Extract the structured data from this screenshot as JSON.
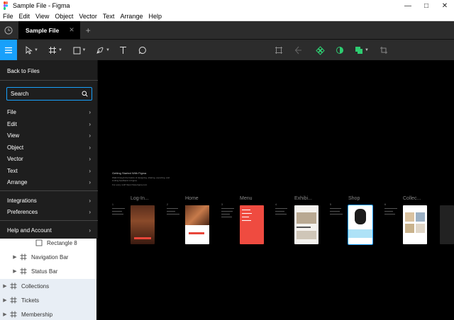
{
  "window": {
    "title": "Sample File - Figma"
  },
  "menubar": [
    "File",
    "Edit",
    "View",
    "Object",
    "Vector",
    "Text",
    "Arrange",
    "Help"
  ],
  "tabs": {
    "active": "Sample File"
  },
  "main_menu": {
    "back": "Back to Files",
    "search_placeholder": "Search",
    "items": [
      "File",
      "Edit",
      "View",
      "Object",
      "Vector",
      "Text",
      "Arrange"
    ],
    "items2": [
      "Integrations",
      "Preferences"
    ],
    "help": "Help and Account"
  },
  "layers": {
    "rect": "Rectangle 8",
    "nav": "Navigation Bar",
    "status": "Status Bar",
    "collections": "Collections",
    "tickets": "Tickets",
    "membership": "Membership"
  },
  "canvas": {
    "intro_title": "Getting Started With Figma",
    "intro_body": "Walk through the basics of designing, sharing, exporting, and inviting feedback in Figma.",
    "intro_link": "For every stuff https://help.figma.com",
    "frames": [
      "Log-In...",
      "Home",
      "Menu",
      "Exhibi...",
      "Shop",
      "Collec..."
    ],
    "numbers": [
      "1",
      "2",
      "3",
      "4",
      "5",
      "6"
    ]
  }
}
